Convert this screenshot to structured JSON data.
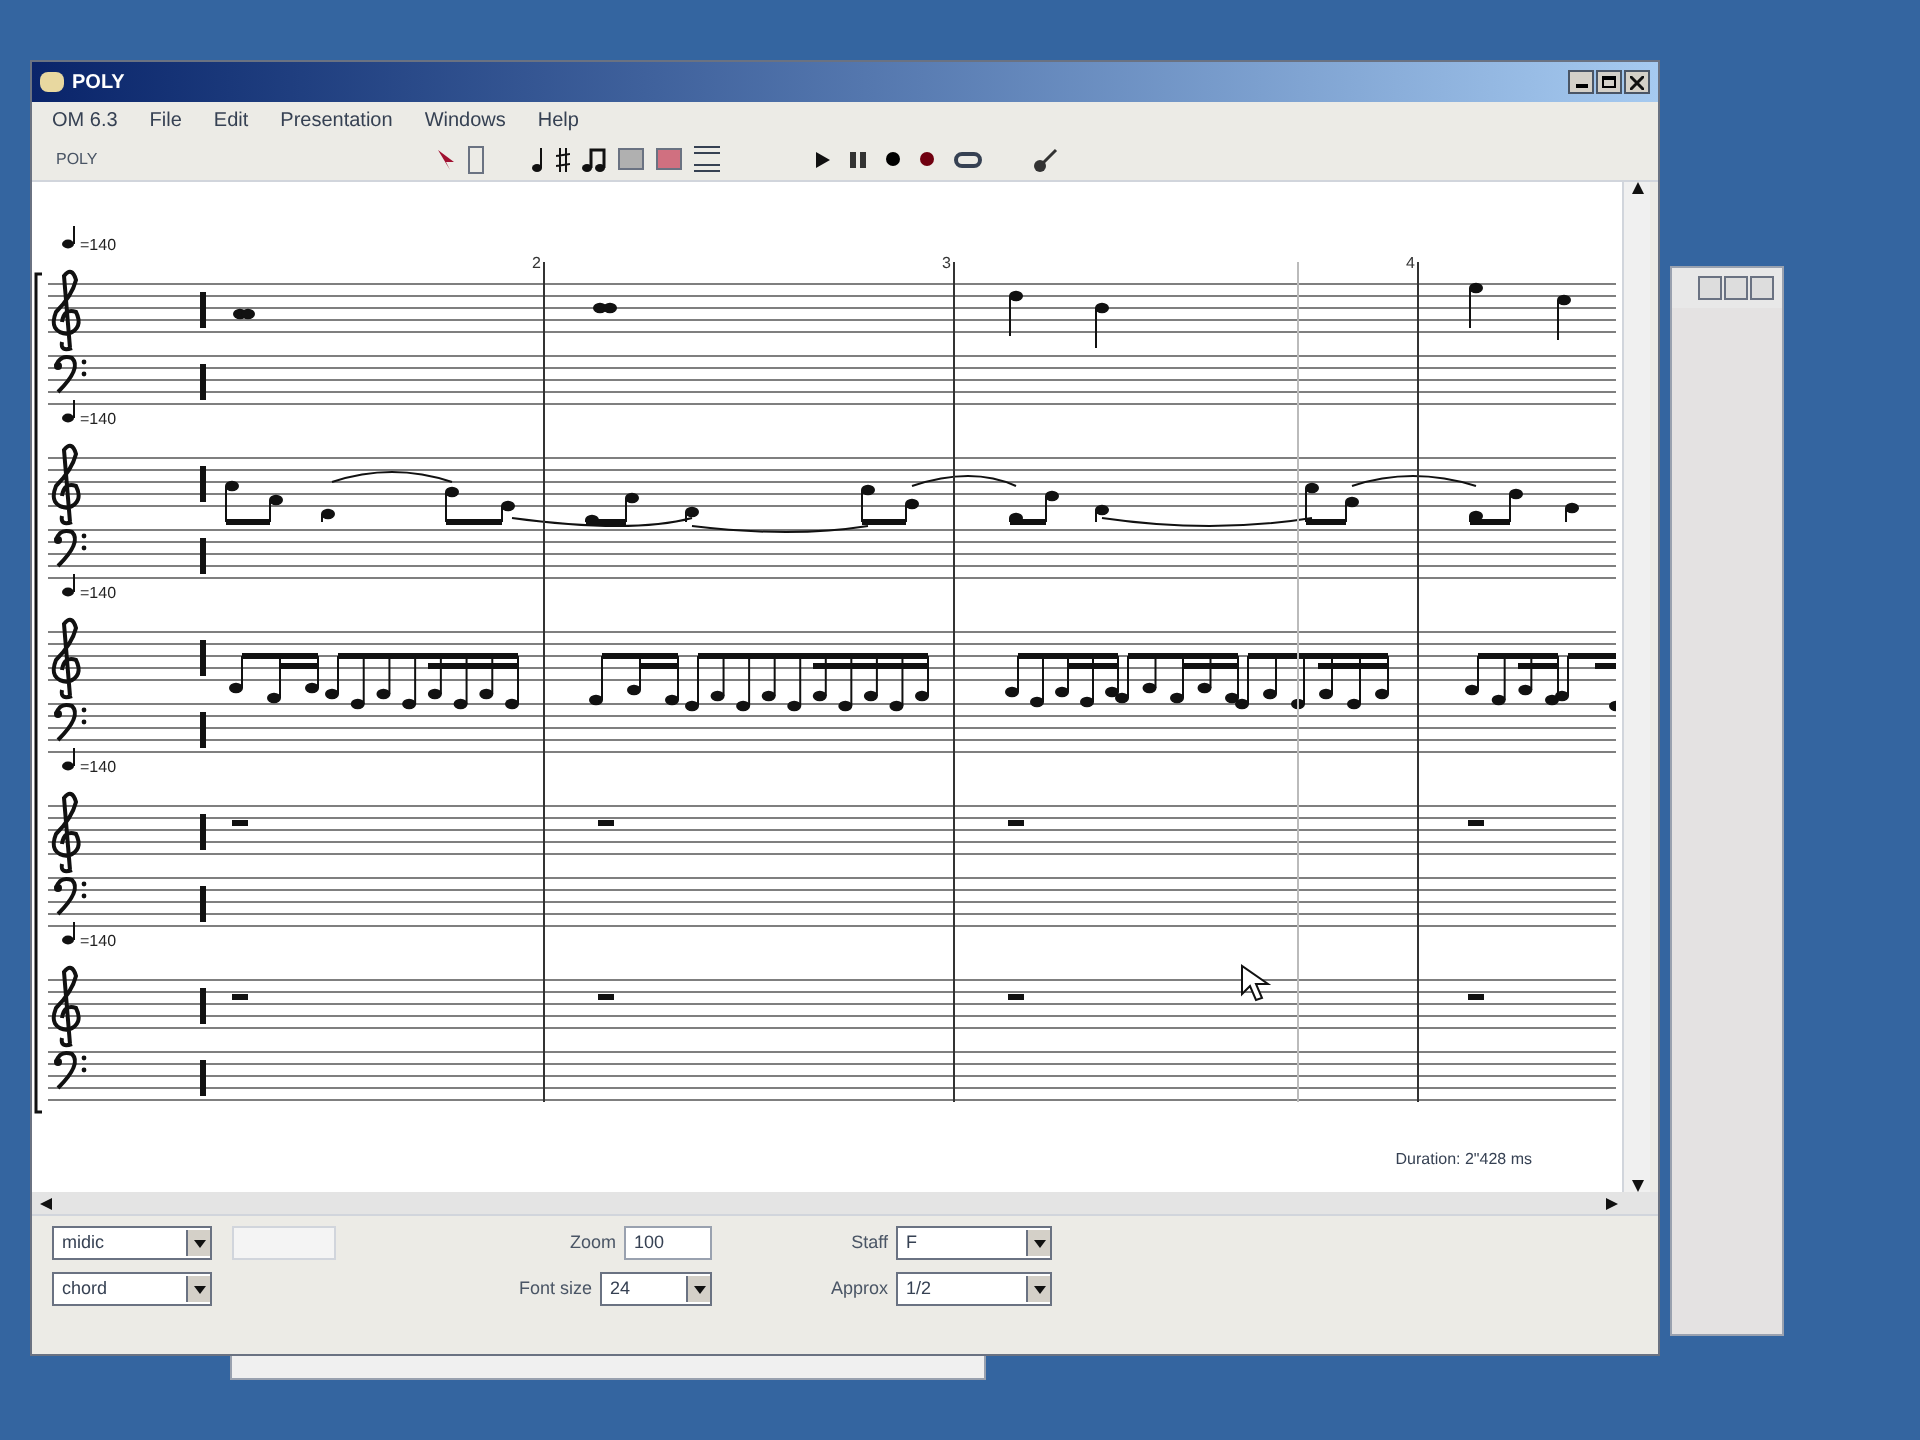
{
  "window": {
    "title": "POLY"
  },
  "menu": [
    "OM 6.3",
    "File",
    "Edit",
    "Presentation",
    "Windows",
    "Help"
  ],
  "toolbar": {
    "label": "POLY"
  },
  "score": {
    "systems": [
      {
        "tempo": "=140",
        "kind": "sparse"
      },
      {
        "tempo": "=140",
        "kind": "beamed"
      },
      {
        "tempo": "=140",
        "kind": "sixteenths"
      },
      {
        "tempo": "=140",
        "kind": "rests"
      },
      {
        "tempo": "=140",
        "kind": "rests"
      }
    ],
    "measure_numbers": [
      "2",
      "3",
      "4"
    ],
    "duration": "Duration: 2\"428 ms"
  },
  "controls": {
    "row_1": [
      {
        "kind": "select",
        "value": "midic"
      },
      {
        "kind": "blank"
      },
      {
        "kind": "input",
        "label": "Zoom",
        "value": "100"
      },
      {
        "kind": "select",
        "label": "Staff",
        "value": "F"
      }
    ],
    "row_2": [
      {
        "kind": "select",
        "value": "chord"
      },
      {
        "kind": "spacer"
      },
      {
        "kind": "select",
        "label": "Font size",
        "value": "24"
      },
      {
        "kind": "select",
        "label": "Approx",
        "value": "1/2"
      }
    ]
  }
}
